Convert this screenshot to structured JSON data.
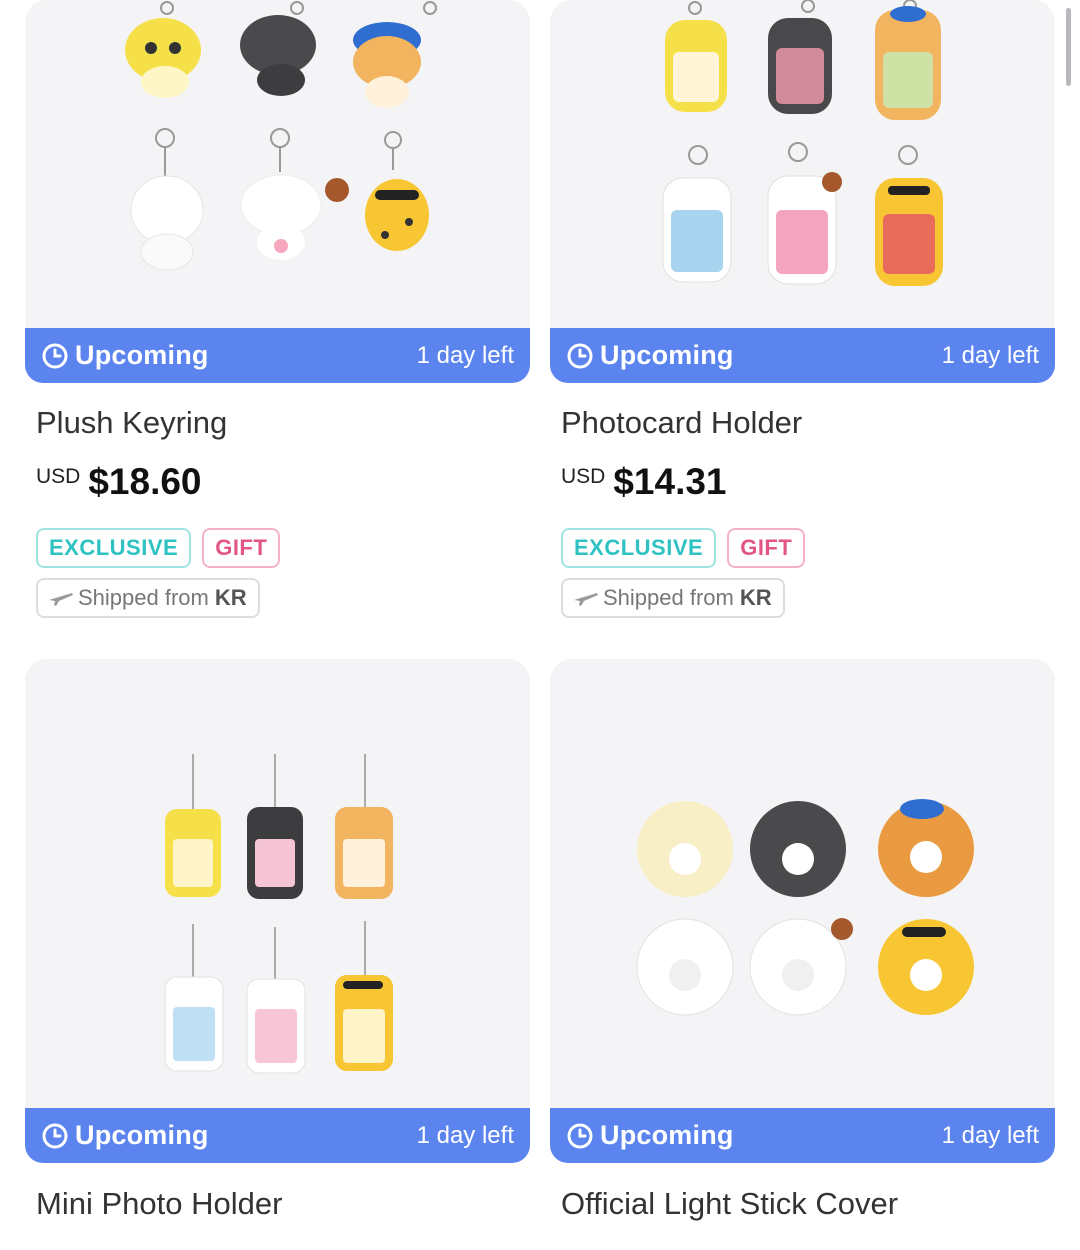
{
  "products": [
    {
      "name": "Plush Keyring",
      "status": "Upcoming",
      "days_left": "1 day left",
      "currency": "USD",
      "price": "$18.60",
      "tags": [
        "EXCLUSIVE",
        "GIFT"
      ],
      "shipping_prefix": "Shipped from",
      "shipping_origin": "KR"
    },
    {
      "name": "Photocard Holder",
      "status": "Upcoming",
      "days_left": "1 day left",
      "currency": "USD",
      "price": "$14.31",
      "tags": [
        "EXCLUSIVE",
        "GIFT"
      ],
      "shipping_prefix": "Shipped from",
      "shipping_origin": "KR"
    },
    {
      "name": "Mini Photo Holder",
      "status": "Upcoming",
      "days_left": "1 day left"
    },
    {
      "name": "Official Light Stick Cover",
      "status": "Upcoming",
      "days_left": "1 day left"
    }
  ],
  "colors": {
    "status_bar": "#5b84ef",
    "exclusive": "#2ec2c2",
    "gift": "#e25586",
    "image_bg": "#f4f4f6"
  },
  "icons": {
    "status": "clock-icon",
    "shipping": "airplane-icon"
  }
}
